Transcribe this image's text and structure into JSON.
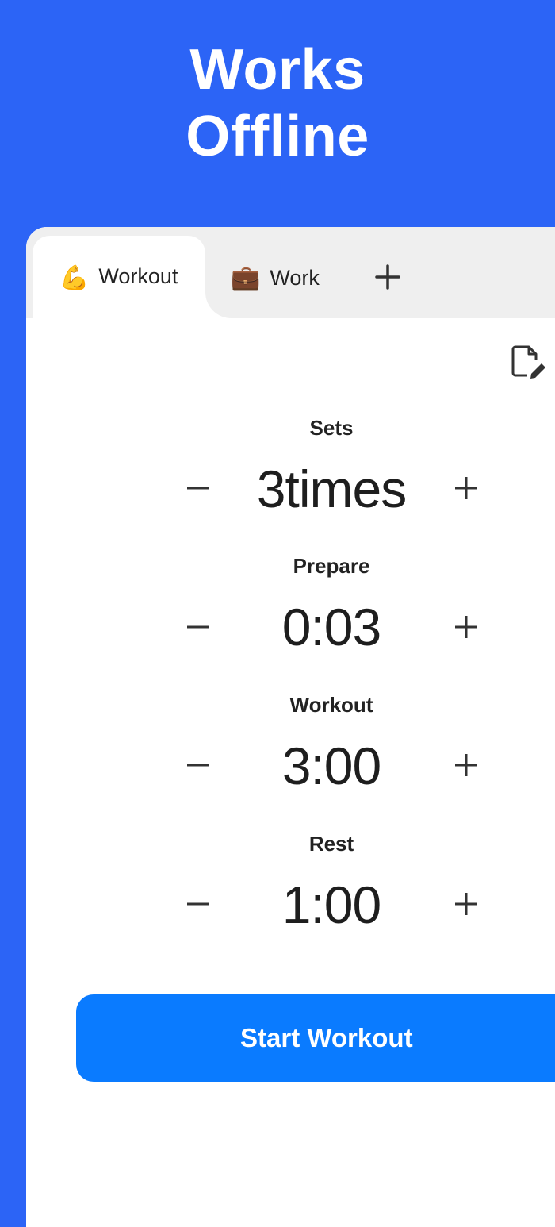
{
  "banner": {
    "line1": "Works",
    "line2": "Offline"
  },
  "tabs": [
    {
      "emoji": "💪",
      "label": "Workout",
      "active": true
    },
    {
      "emoji": "💼",
      "label": "Work",
      "active": false
    }
  ],
  "add_tab_icon": "plus-icon",
  "edit_icon": "edit-note-icon",
  "settings": [
    {
      "label": "Sets",
      "value": "3times"
    },
    {
      "label": "Prepare",
      "value": "0:03"
    },
    {
      "label": "Workout",
      "value": "3:00"
    },
    {
      "label": "Rest",
      "value": "1:00"
    }
  ],
  "start_button": {
    "label": "Start Workout"
  },
  "colors": {
    "background": "#2c64f6",
    "tabbar": "#efefef",
    "accent": "#0a7bff"
  }
}
